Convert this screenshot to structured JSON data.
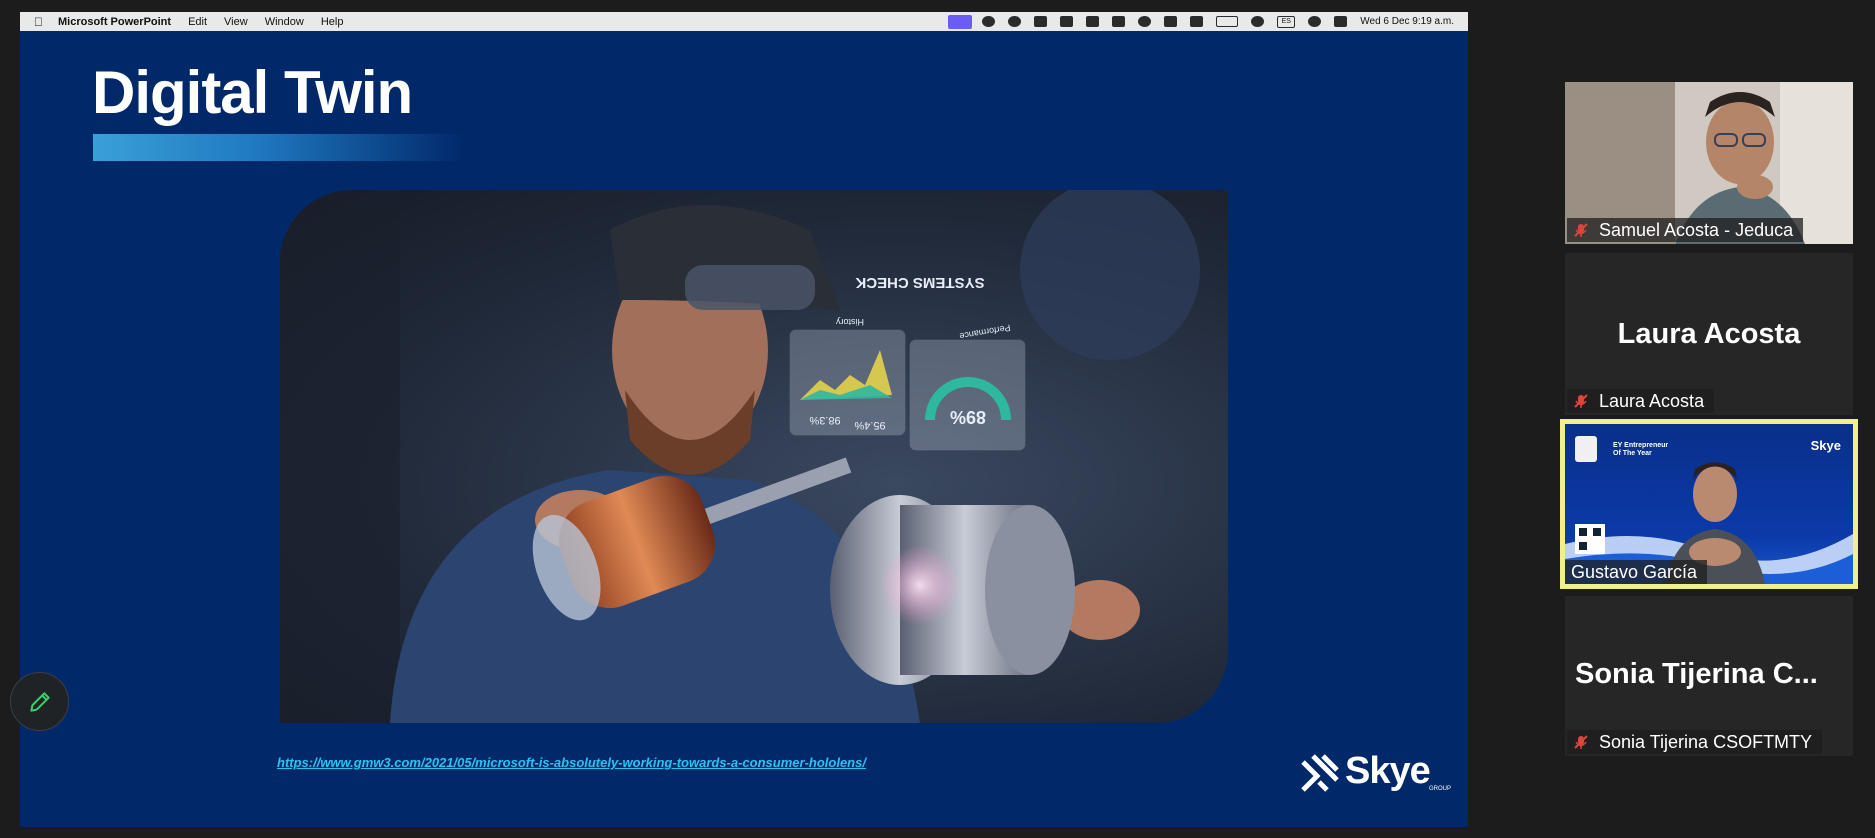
{
  "menubar": {
    "app_name": "Microsoft PowerPoint",
    "menus": [
      "Edit",
      "View",
      "Window",
      "Help"
    ],
    "input_source": "ES",
    "clock": "Wed 6 Dec  9:19 a.m."
  },
  "slide": {
    "title": "Digital Twin",
    "source_link": "https://www.gmw3.com/2021/05/microsoft-is-absolutely-working-towards-a-consumer-hololens/",
    "image": {
      "hud_title": "SYSTEMS CHECK",
      "hud_left_label": "History",
      "hud_right_label": "Performance",
      "hud_value_a": "98.3%",
      "hud_value_b": "95.4%",
      "hud_gauge_value": "89%"
    },
    "logo": {
      "wordmark": "Skye",
      "tagline": "GROUP"
    }
  },
  "participants": [
    {
      "name": "Samuel Acosta -  Jeduca",
      "muted": true,
      "video": true
    },
    {
      "name": "Laura Acosta",
      "display_name": "Laura Acosta",
      "muted": true,
      "video": false
    },
    {
      "name": "Gustavo García",
      "muted": false,
      "video": true,
      "active_speaker": true,
      "background_text": {
        "badge": "EY Entrepreneur Of The Year",
        "brand": "Skye"
      }
    },
    {
      "name": "Sonia Tijerina CSOFTMTY",
      "display_name": "Sonia Tijerina C...",
      "muted": true,
      "video": false
    }
  ],
  "colors": {
    "slide_background": "#01296a",
    "link": "#27c4f4",
    "active_speaker_border": "#f0f08a",
    "muted_icon": "#e0443a"
  }
}
